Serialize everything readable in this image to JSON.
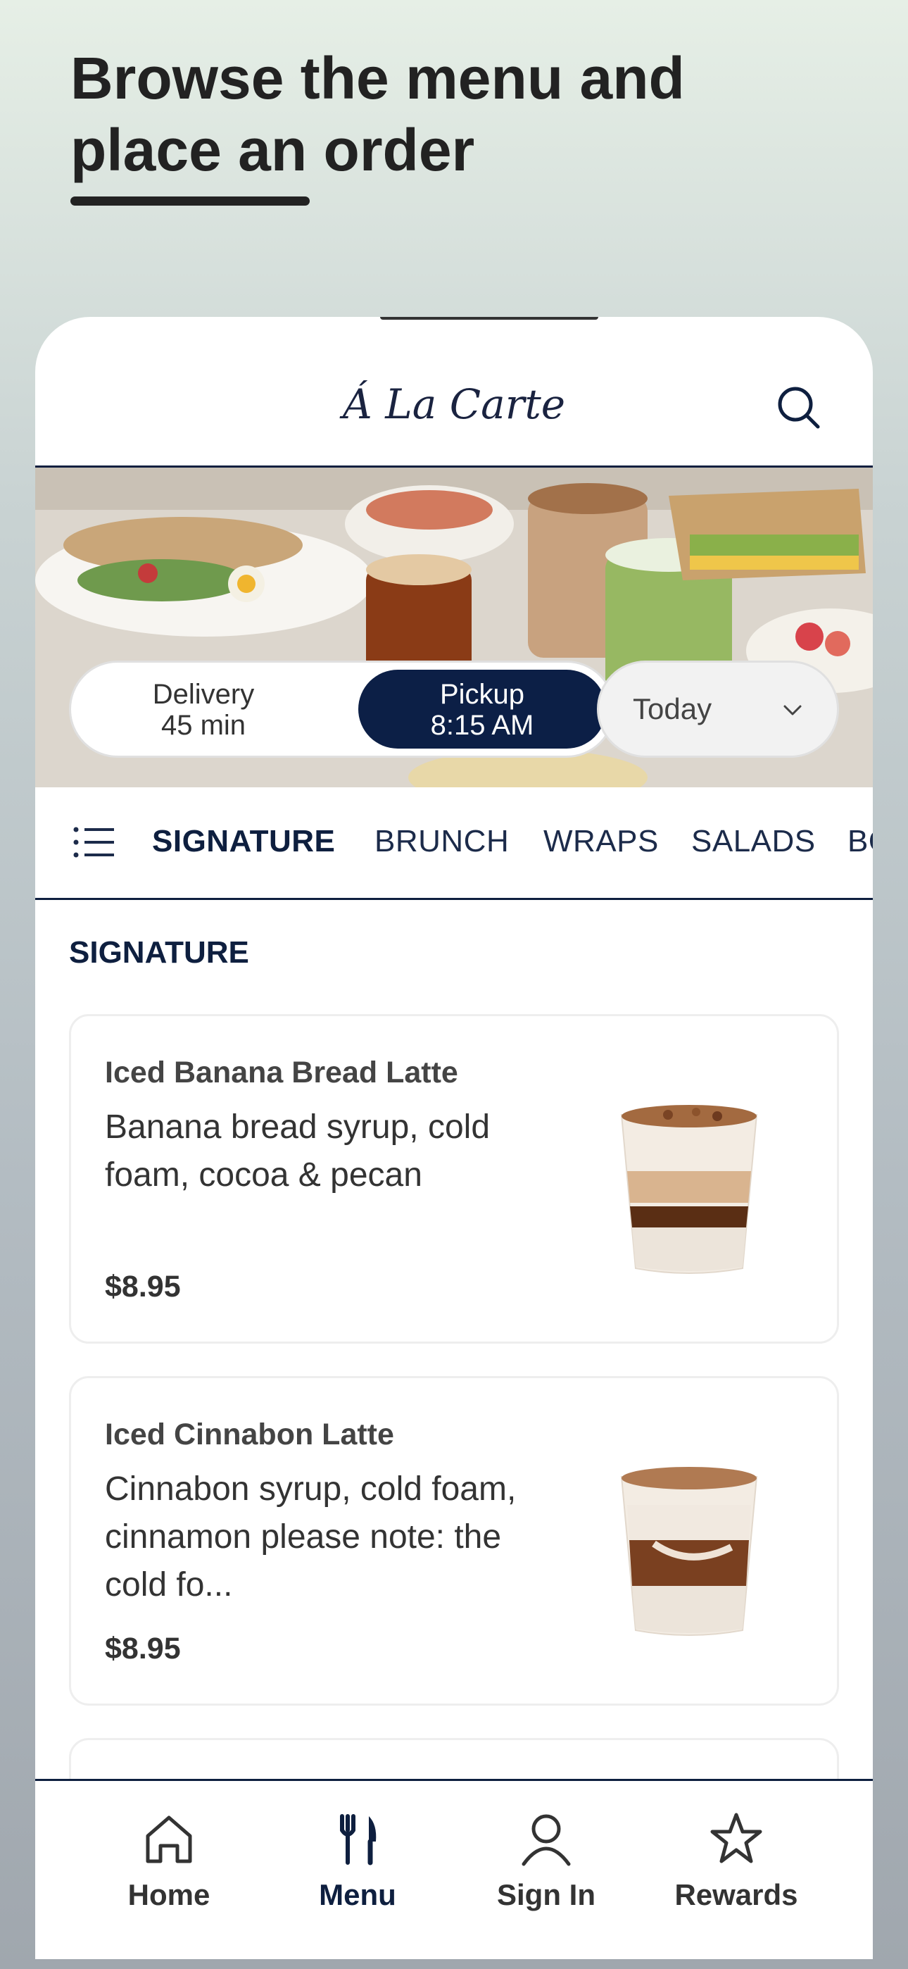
{
  "intro": {
    "headline_line1": "Browse the menu and",
    "headline_line2": "place an order"
  },
  "app": {
    "logo_text": "Á La Carte",
    "search_icon": "search-icon"
  },
  "order_mode": {
    "delivery_label": "Delivery",
    "delivery_time": "45 min",
    "pickup_label": "Pickup",
    "pickup_time": "8:15 AM",
    "selected": "pickup"
  },
  "day_select": {
    "value": "Today"
  },
  "categories": {
    "items": [
      "SIGNATURE",
      "BRUNCH",
      "WRAPS",
      "SALADS",
      "BOWLS"
    ],
    "active": "SIGNATURE"
  },
  "section": {
    "title": "SIGNATURE"
  },
  "menu_items": [
    {
      "name": "Iced Banana Bread Latte",
      "description": "Banana bread syrup, cold foam, cocoa & pecan",
      "price": "$8.95"
    },
    {
      "name": "Iced Cinnabon Latte",
      "description": "Cinnabon syrup, cold foam, cinnamon please note: the cold fo...",
      "price": "$8.95"
    }
  ],
  "tabbar": {
    "home": "Home",
    "menu": "Menu",
    "sign_in": "Sign In",
    "rewards": "Rewards",
    "active": "menu"
  },
  "colors": {
    "navy": "#0c1f46",
    "text_dark": "#333333",
    "bg_top": "#e6efe6",
    "bg_bottom": "#a0a7ae"
  }
}
